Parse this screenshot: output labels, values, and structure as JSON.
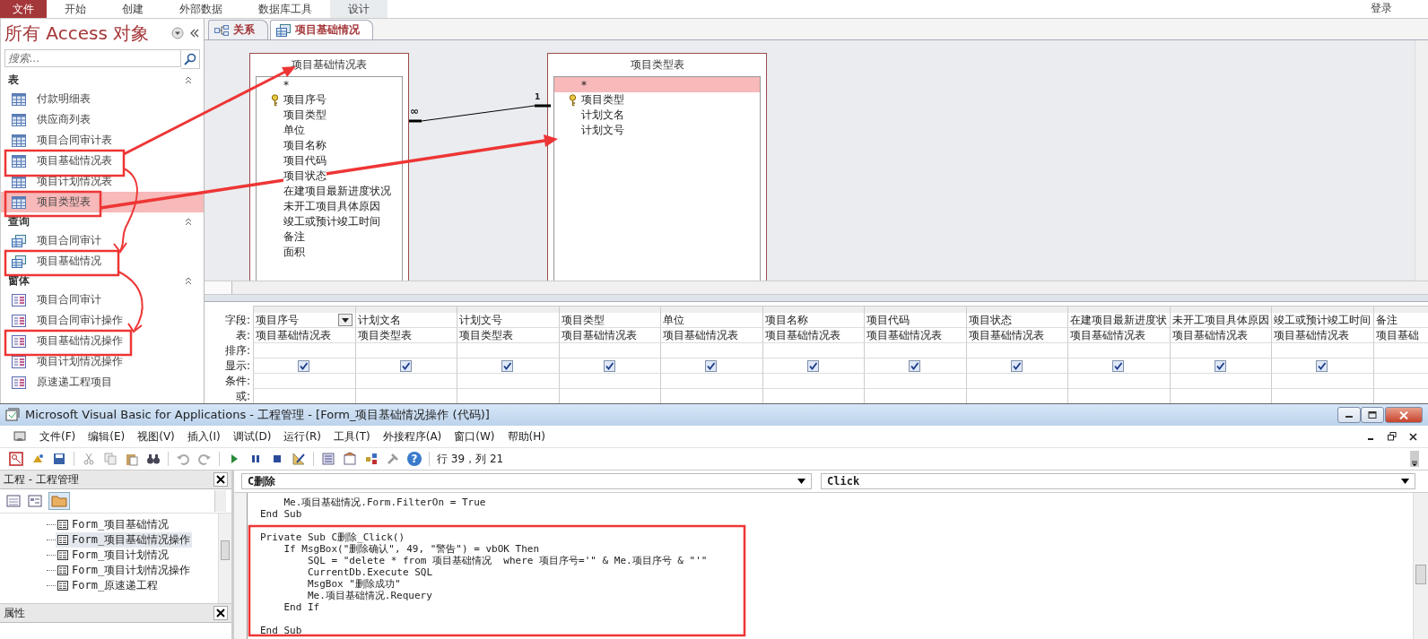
{
  "ribbon": {
    "tabs": [
      {
        "label": "文件",
        "kind": "file",
        "selected": false
      },
      {
        "label": "开始",
        "kind": "tab",
        "selected": false
      },
      {
        "label": "创建",
        "kind": "tab",
        "selected": false
      },
      {
        "label": "外部数据",
        "kind": "tab",
        "selected": false
      },
      {
        "label": "数据库工具",
        "kind": "tab",
        "selected": false
      },
      {
        "label": "设计",
        "kind": "tab",
        "selected": true
      }
    ],
    "account": "登录"
  },
  "nav": {
    "title": "所有 Access 对象",
    "search_placeholder": "搜索...",
    "groups": [
      {
        "label": "表",
        "kind": "table",
        "items": [
          {
            "label": "付款明细表",
            "selected": false
          },
          {
            "label": "供应商列表",
            "selected": false
          },
          {
            "label": "项目合同审计表",
            "selected": false
          },
          {
            "label": "项目基础情况表",
            "selected": false
          },
          {
            "label": "项目计划情况表",
            "selected": false
          },
          {
            "label": "项目类型表",
            "selected": true
          }
        ]
      },
      {
        "label": "查询",
        "kind": "query",
        "items": [
          {
            "label": "项目合同审计",
            "selected": false
          },
          {
            "label": "项目基础情况",
            "selected": false
          }
        ]
      },
      {
        "label": "窗体",
        "kind": "form",
        "items": [
          {
            "label": "项目合同审计",
            "selected": false
          },
          {
            "label": "项目合同审计操作",
            "selected": false
          },
          {
            "label": "项目基础情况操作",
            "selected": false
          },
          {
            "label": "项目计划情况操作",
            "selected": false
          },
          {
            "label": "原速递工程项目",
            "selected": false
          }
        ]
      }
    ]
  },
  "doc_tabs": [
    {
      "label": "关系",
      "kind": "relationship",
      "selected": false
    },
    {
      "label": "项目基础情况",
      "kind": "query",
      "selected": true
    }
  ],
  "relationship": {
    "tables": [
      {
        "title": "项目基础情况表",
        "fields": [
          {
            "name": "*",
            "key": false,
            "selected": false
          },
          {
            "name": "项目序号",
            "key": true,
            "selected": false
          },
          {
            "name": "项目类型",
            "key": false,
            "selected": false
          },
          {
            "name": "单位",
            "key": false,
            "selected": false
          },
          {
            "name": "项目名称",
            "key": false,
            "selected": false
          },
          {
            "name": "项目代码",
            "key": false,
            "selected": false
          },
          {
            "name": "项目状态",
            "key": false,
            "selected": false
          },
          {
            "name": "在建项目最新进度状况",
            "key": false,
            "selected": false
          },
          {
            "name": "未开工项目具体原因",
            "key": false,
            "selected": false
          },
          {
            "name": "竣工或预计竣工时间",
            "key": false,
            "selected": false
          },
          {
            "name": "备注",
            "key": false,
            "selected": false
          },
          {
            "name": "面积",
            "key": false,
            "selected": false
          }
        ]
      },
      {
        "title": "项目类型表",
        "fields": [
          {
            "name": "*",
            "key": false,
            "selected": true
          },
          {
            "name": "项目类型",
            "key": true,
            "selected": false
          },
          {
            "name": "计划文名",
            "key": false,
            "selected": false
          },
          {
            "name": "计划文号",
            "key": false,
            "selected": false
          }
        ]
      }
    ],
    "join": {
      "many": "∞",
      "one": "1"
    }
  },
  "qbe": {
    "row_labels": [
      "字段:",
      "表:",
      "排序:",
      "显示:",
      "条件:",
      "或:"
    ],
    "columns": [
      {
        "field": "项目序号",
        "table": "项目基础情况表",
        "show": true,
        "dropdown": true
      },
      {
        "field": "计划文名",
        "table": "项目类型表",
        "show": true,
        "dropdown": false
      },
      {
        "field": "计划文号",
        "table": "项目类型表",
        "show": true,
        "dropdown": false
      },
      {
        "field": "项目类型",
        "table": "项目基础情况表",
        "show": true,
        "dropdown": false
      },
      {
        "field": "单位",
        "table": "项目基础情况表",
        "show": true,
        "dropdown": false
      },
      {
        "field": "项目名称",
        "table": "项目基础情况表",
        "show": true,
        "dropdown": false
      },
      {
        "field": "项目代码",
        "table": "项目基础情况表",
        "show": true,
        "dropdown": false
      },
      {
        "field": "项目状态",
        "table": "项目基础情况表",
        "show": true,
        "dropdown": false
      },
      {
        "field": "在建项目最新进度状",
        "table": "项目基础情况表",
        "show": true,
        "dropdown": false
      },
      {
        "field": "未开工项目具体原因",
        "table": "项目基础情况表",
        "show": true,
        "dropdown": false
      },
      {
        "field": "竣工或预计竣工时间",
        "table": "项目基础情况表",
        "show": true,
        "dropdown": false
      },
      {
        "field": "备注",
        "table": "项目基础",
        "dropdown": false
      }
    ]
  },
  "vba": {
    "title": "Microsoft Visual Basic for Applications - 工程管理 - [Form_项目基础情况操作 (代码)]",
    "menu": [
      "文件(F)",
      "编辑(E)",
      "视图(V)",
      "插入(I)",
      "调试(D)",
      "运行(R)",
      "工具(T)",
      "外接程序(A)",
      "窗口(W)",
      "帮助(H)"
    ],
    "help_glyph": "?",
    "position": "行 39，列 21",
    "project": {
      "title": "工程 - 工程管理",
      "items": [
        {
          "label": "Form_项目基础情况",
          "selected": false
        },
        {
          "label": "Form_项目基础情况操作",
          "selected": true
        },
        {
          "label": "Form_项目计划情况",
          "selected": false
        },
        {
          "label": "Form_项目计划情况操作",
          "selected": false
        },
        {
          "label": "Form_原速递工程",
          "selected": false
        }
      ]
    },
    "properties_title": "属性",
    "object_combo": "C删除",
    "procedure_combo": "Click",
    "code": [
      [
        "    Me.项目基础情况.Form.FilterOn = True",
        "End Sub"
      ],
      [
        "Private Sub C删除_Click()",
        "    If MsgBox(\"删除确认\", 49, \"警告\") = vbOK Then",
        "        SQL = \"delete * from 项目基础情况  where 项目序号='\" & Me.项目序号 & \"'\"",
        "        CurrentDb.Execute SQL",
        "        MsgBox \"删除成功\"",
        "        Me.项目基础情况.Requery",
        "    End If"
      ],
      [
        "End Sub"
      ]
    ]
  }
}
